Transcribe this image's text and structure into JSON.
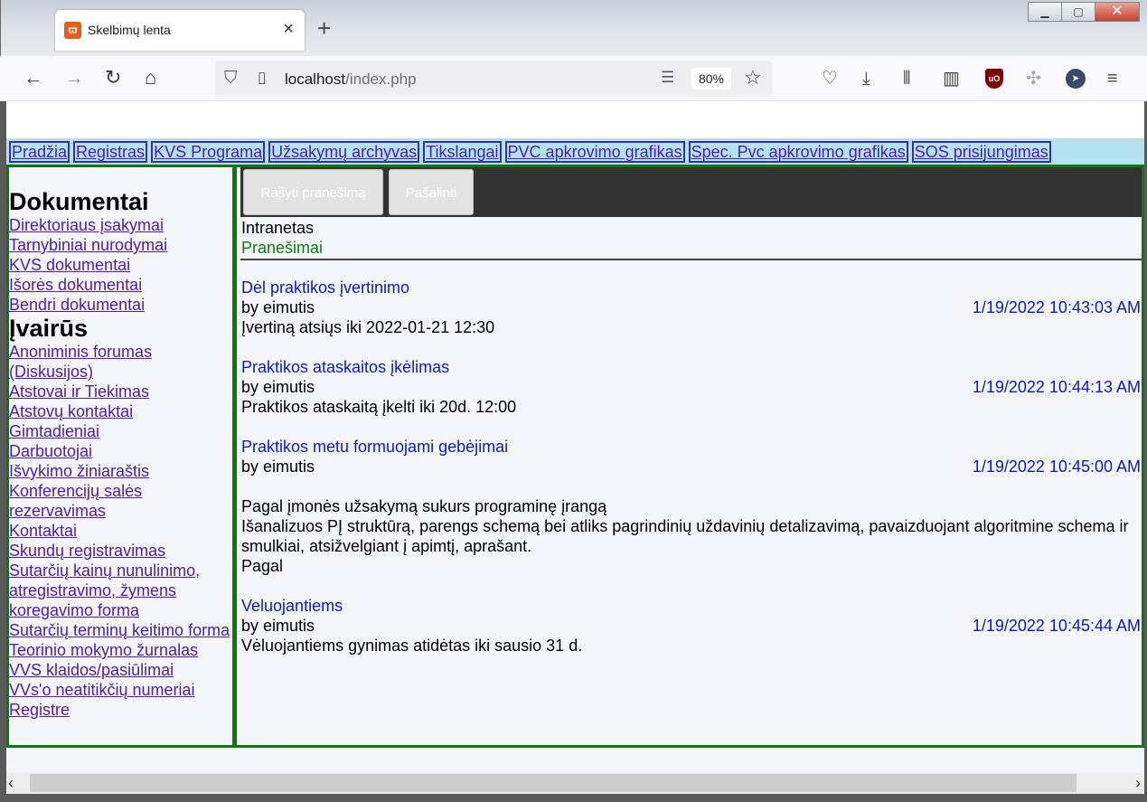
{
  "browser": {
    "tab_title": "Skelbimų lenta",
    "url_host": "localhost",
    "url_path": "/index.php",
    "zoom": "80%"
  },
  "topnav": [
    "Pradžia",
    "Registras",
    "KVS Programa",
    "Užsakymų archyvas",
    "Tikslangai",
    "PVC apkrovimo grafikas",
    "Spec. Pvc apkrovimo grafikas",
    "SOS prisijungimas"
  ],
  "sidebar": {
    "heading1": "Dokumentai",
    "docs": [
      "Direktoriaus įsakymai",
      "Tarnybiniai nurodymai",
      "KVS dokumentai",
      "Išorės dokumentai",
      "Bendri dokumentai"
    ],
    "heading2": "Įvairūs",
    "misc": [
      "Anoniminis forumas (Diskusijos)",
      "Atstovai ir Tiekimas",
      "Atstovų kontaktai",
      "Gimtadieniai",
      "Darbuotojai",
      "Išvykimo žiniaraštis",
      "Konferencijų salės rezervavimas",
      "Kontaktai",
      "Skundų registravimas",
      "Sutarčių kainų nunulinimo, atregistravimo, žymens koregavimo forma",
      "Sutarčių terminų keitimo forma",
      "Teorinio mokymo žurnalas",
      "VVS klaidos/pasiūlimai",
      "VVs'o neatitikčių numeriai",
      "Registre"
    ]
  },
  "toolbar": {
    "write": "Rašyti pranešimą",
    "remove": "Pašalinti"
  },
  "breadcrumb": {
    "section": "Intranetas",
    "page": "Pranešimai"
  },
  "posts": [
    {
      "title": "Dėl praktikos įvertinimo",
      "author": "by eimutis",
      "date": "1/19/2022 10:43:03 AM",
      "body": "Įvertiną atsiųs iki 2022-01-21 12:30"
    },
    {
      "title": "Praktikos ataskaitos įkėlimas",
      "author": "by eimutis",
      "date": "1/19/2022 10:44:13 AM",
      "body": "Praktikos ataskaitą įkelti iki 20d. 12:00"
    },
    {
      "title": "Praktikos metu formuojami gebėjimai",
      "author": "by eimutis",
      "date": "1/19/2022 10:45:00 AM",
      "body": "\nPagal įmonės užsakymą sukurs programinę įrangą\nIšanalizuos PĮ struktūrą, parengs schemą bei atliks pagrindinių uždavinių detalizavimą, pavaizduojant algoritmine schema ir smulkiai, atsižvelgiant į apimtį, aprašant.\nPagal"
    },
    {
      "title": "Veluojantiems",
      "author": "by eimutis",
      "date": "1/19/2022 10:45:44 AM",
      "body": "Vėluojantiems gynimas atidėtas iki sausio 31 d."
    }
  ],
  "colors": {
    "nav_bg": "#b3e3f2",
    "link": "#4b1db1",
    "frame_border": "#0b7a0b",
    "post_title": "#0b16d6",
    "breadcrumb_active": "#0b800b",
    "toolbar_bg": "#333333"
  }
}
